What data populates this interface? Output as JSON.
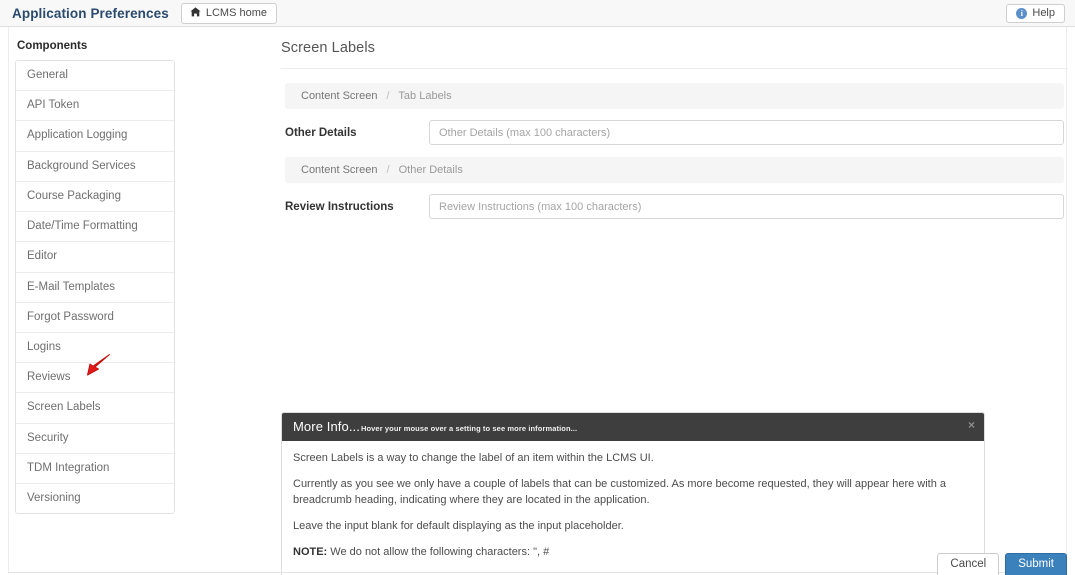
{
  "navbar": {
    "brand": "Application Preferences",
    "home_button": {
      "label": "LCMS home",
      "icon": "home-icon",
      "glyph": "⌂"
    },
    "help_button": {
      "label": "Help",
      "icon": "info-circle-icon",
      "glyph": "i"
    }
  },
  "sidebar": {
    "title": "Components",
    "items": [
      {
        "label": "General"
      },
      {
        "label": "API Token"
      },
      {
        "label": "Application Logging"
      },
      {
        "label": "Background Services"
      },
      {
        "label": "Course Packaging"
      },
      {
        "label": "Date/Time Formatting"
      },
      {
        "label": "Editor"
      },
      {
        "label": "E-Mail Templates"
      },
      {
        "label": "Forgot Password"
      },
      {
        "label": "Logins"
      },
      {
        "label": "Reviews"
      },
      {
        "label": "Screen Labels"
      },
      {
        "label": "Security"
      },
      {
        "label": "TDM Integration"
      },
      {
        "label": "Versioning"
      }
    ]
  },
  "main": {
    "page_title": "Screen Labels",
    "sections": [
      {
        "breadcrumb_parent": "Content Screen",
        "breadcrumb_sep": "/",
        "breadcrumb_current": "Tab Labels",
        "field_label": "Other Details",
        "field_value": "",
        "field_placeholder": "Other Details (max 100 characters)"
      },
      {
        "breadcrumb_parent": "Content Screen",
        "breadcrumb_sep": "/",
        "breadcrumb_current": "Other Details",
        "field_label": "Review Instructions",
        "field_value": "",
        "field_placeholder": "Review Instructions (max 100 characters)"
      }
    ]
  },
  "more_info": {
    "title": "More Info...",
    "subtitle": "Hover your mouse over a setting to see more information...",
    "close_glyph": "×",
    "paragraphs": [
      "Screen Labels is a way to change the label of an item within the LCMS UI.",
      "Currently as you see we only have a couple of labels that can be customized. As more become requested, they will appear here with a breadcrumb heading, indicating where they are located in the application.",
      "Leave the input blank for default displaying as the input placeholder."
    ],
    "note_label": "NOTE:",
    "note_text": " We do not allow the following characters: \", #"
  },
  "footer": {
    "cancel_label": "Cancel",
    "submit_label": "Submit"
  },
  "colors": {
    "brand_navy": "#2b4a6f",
    "primary_blue": "#3b82bd",
    "panel_header_dark": "#3e3e3e",
    "muted_gray": "#6f6f6f",
    "cursor_red": "#e11b1b"
  }
}
